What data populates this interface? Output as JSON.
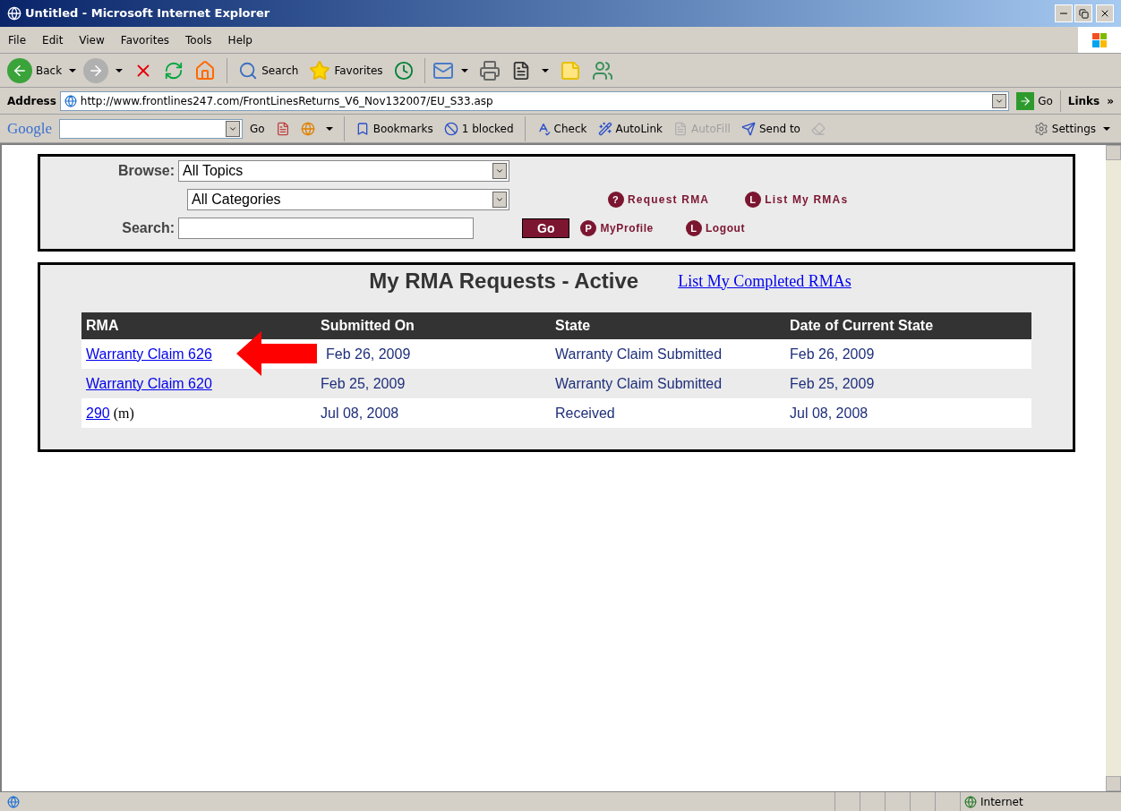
{
  "window": {
    "title": "Untitled - Microsoft Internet Explorer"
  },
  "menu": [
    "File",
    "Edit",
    "View",
    "Favorites",
    "Tools",
    "Help"
  ],
  "toolbar": {
    "back": "Back",
    "search": "Search",
    "favorites": "Favorites"
  },
  "address_bar": {
    "label": "Address",
    "url": "http://www.frontlines247.com/FrontLinesReturns_V6_Nov132007/EU_S33.asp",
    "go": "Go",
    "links": "Links",
    "more": "»"
  },
  "google_bar": {
    "logo": "Google",
    "items": [
      {
        "label": "Go",
        "disabled": false
      },
      {
        "label": "Bookmarks",
        "disabled": false
      },
      {
        "label": "1 blocked",
        "disabled": false
      },
      {
        "label": "Check",
        "disabled": false
      },
      {
        "label": "AutoLink",
        "disabled": false
      },
      {
        "label": "AutoFill",
        "disabled": true
      },
      {
        "label": "Send to",
        "disabled": false
      }
    ],
    "settings": "Settings"
  },
  "search_panel": {
    "browse_label": "Browse:",
    "topics": "All Topics",
    "categories": "All Categories",
    "search_label": "Search:",
    "go": "Go",
    "links": [
      {
        "badge": "?",
        "label": "Request RMA"
      },
      {
        "badge": "L",
        "label": "List My RMAs"
      },
      {
        "badge": "P",
        "label": "MyProfile"
      },
      {
        "badge": "L",
        "label": "Logout"
      }
    ]
  },
  "rma_panel": {
    "title": "My RMA Requests - Active",
    "completed_link": "List My Completed RMAs",
    "columns": [
      "RMA",
      "Submitted On",
      "State",
      "Date of Current State"
    ],
    "rows": [
      {
        "rma": "Warranty Claim 626",
        "suffix": "",
        "submitted": "Feb 26, 2009",
        "state": "Warranty Claim Submitted",
        "date": "Feb 26, 2009"
      },
      {
        "rma": "Warranty Claim 620",
        "suffix": "",
        "submitted": "Feb 25, 2009",
        "state": "Warranty Claim Submitted",
        "date": "Feb 25, 2009"
      },
      {
        "rma": "290",
        "suffix": "(m)",
        "submitted": "Jul 08, 2008",
        "state": "Received",
        "date": "Jul 08, 2008"
      }
    ]
  },
  "status_bar": {
    "zone": "Internet"
  }
}
